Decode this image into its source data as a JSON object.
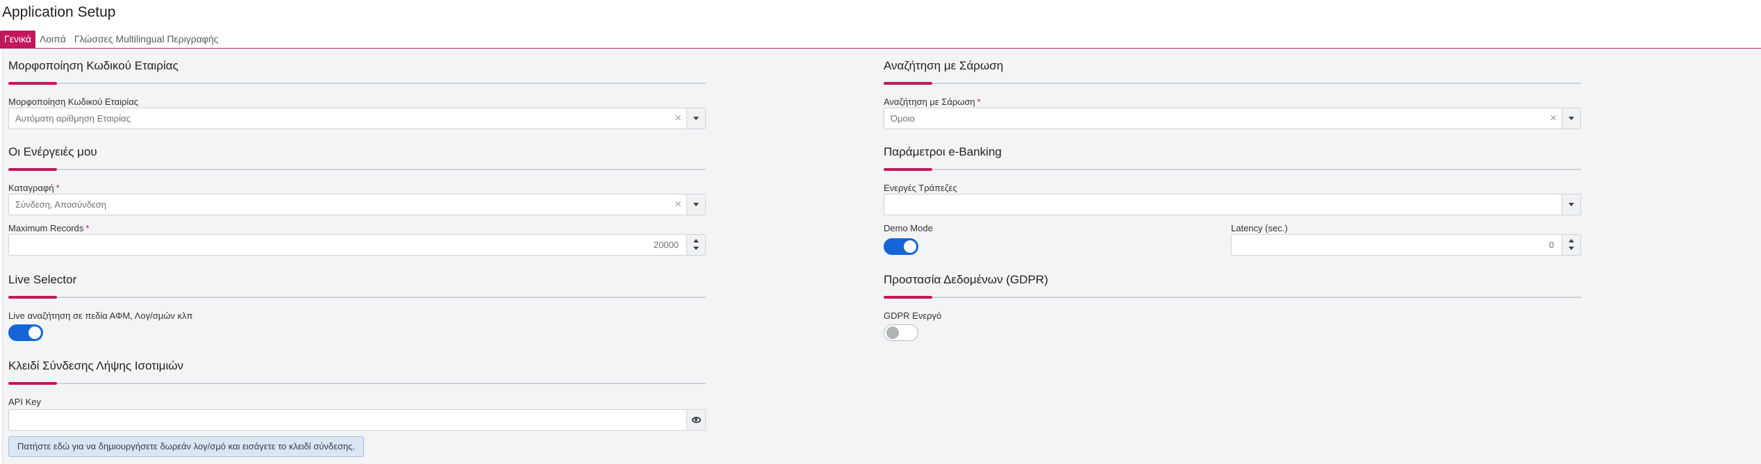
{
  "app": {
    "title": "Application Setup"
  },
  "tabs": [
    {
      "label": "Γενικά",
      "active": true
    },
    {
      "label": "Λοιπά",
      "active": false
    },
    {
      "label": "Γλώσσες Multilingual Περιγραφής",
      "active": false
    }
  ],
  "left": {
    "company_format": {
      "title": "Μορφοποίηση Κωδικού Εταιρίας",
      "field_label": "Μορφοποίηση Κωδικού Εταιρίας",
      "value": "Αυτόματη αρίθμηση Εταιρίας"
    },
    "my_actions": {
      "title": "Οι Ενέργειές μου",
      "log_label": "Καταγραφή",
      "log_value": "Σύνδεση, Αποσύνδεση",
      "max_label": "Maximum Records",
      "max_value": "20000"
    },
    "live_selector": {
      "title": "Live Selector",
      "toggle_label": "Live αναζήτηση σε πεδία ΑΦΜ, Λογ/σμών κλπ",
      "enabled": true
    },
    "fx_key": {
      "title": "Κλειδί Σύνδεσης Λήψης Ισοτιμιών",
      "api_label": "API Key",
      "api_value": "",
      "button_label": "Πατήστε εδώ για να δημιουργήσετε δωρεάν λογ/σμό και εισάγετε το κλειδί σύνδεσης."
    }
  },
  "right": {
    "scan_search": {
      "title": "Αναζήτηση με Σάρωση",
      "field_label": "Αναζήτηση με Σάρωση",
      "value": "Όμοιο"
    },
    "ebanking": {
      "title": "Παράμετροι e-Banking",
      "banks_label": "Ενεργές Τράπεζες",
      "banks_value": "",
      "demo_label": "Demo Mode",
      "demo_enabled": true,
      "latency_label": "Latency (sec.)",
      "latency_value": "0"
    },
    "gdpr": {
      "title": "Προστασία Δεδομένων (GDPR)",
      "toggle_label": "GDPR Ενεργό",
      "enabled": false
    }
  },
  "colors": {
    "accent": "#c2185b",
    "toggle_on": "#1565d8",
    "background": "#f2f4f6"
  },
  "icons": {
    "clear": "x-icon",
    "dropdown": "chevron-down-icon",
    "spinner": "spinner-arrows-icon",
    "reveal": "eye-icon"
  }
}
